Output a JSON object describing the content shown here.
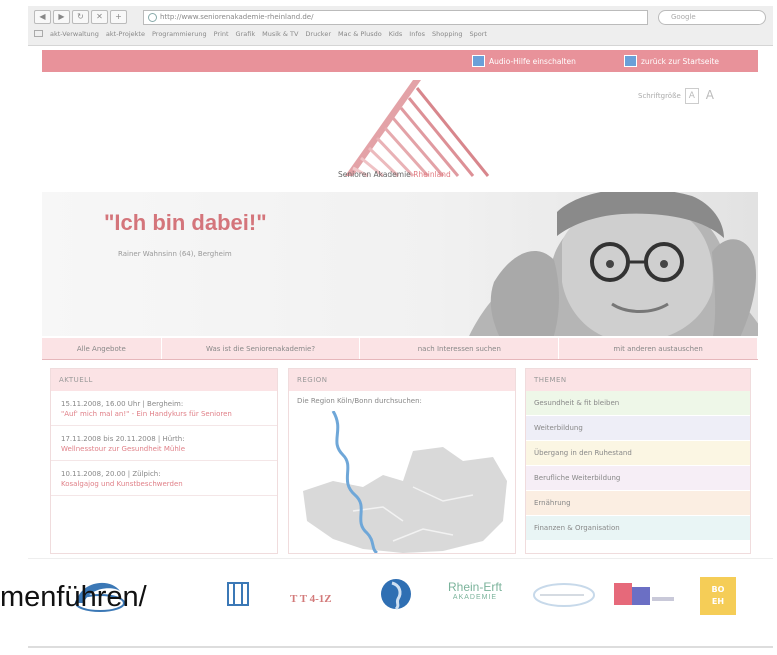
{
  "browser": {
    "url": "http://www.seniorenakademie-rheinland.de/",
    "search_placeholder": "Google",
    "bookmarks": [
      "akt-Verwaltung",
      "akt-Projekte",
      "Programmierung",
      "Print",
      "Grafik",
      "Musik & TV",
      "Drucker",
      "Mac & Plusdo",
      "Kids",
      "Infos",
      "Shopping",
      "Sport"
    ]
  },
  "topbar": {
    "link1": "Audio-Hilfe einschalten",
    "link2": "zurück zur Startseite",
    "bg_color": "#e8929a"
  },
  "header": {
    "brand_main": "Senioren Akademie",
    "brand_highlight": "Rheinland",
    "font_size_label": "Schriftgröße",
    "font_small": "A",
    "font_large": "A"
  },
  "hero": {
    "quote": "\"Ich bin dabei!\"",
    "subline": "Rainer Wahnsinn (64), Bergheim"
  },
  "tabs": [
    "Alle Angebote",
    "Was ist die Seniorenakademie?",
    "nach Interessen suchen",
    "mit anderen austauschen"
  ],
  "aktuell": {
    "title": "AKTUELL",
    "items": [
      {
        "date": "15.11.2008, 16.00 Uhr | Bergheim:",
        "text": "\"Auf' mich mal an!\" - Ein Handykurs für Senioren"
      },
      {
        "date": "17.11.2008 bis 20.11.2008 | Hürth:",
        "text": "Wellnesstour zur Gesundheit Mühle"
      },
      {
        "date": "10.11.2008, 20.00 | Zülpich:",
        "text": "Kosalgajog und Kunstbeschwerden"
      }
    ]
  },
  "region": {
    "title": "REGION",
    "text": "Die Region Köln/Bonn durchsuchen:"
  },
  "themen": {
    "title": "THEMEN",
    "items": [
      {
        "label": "Gesundheit & fit bleiben",
        "color": "#eef7e8"
      },
      {
        "label": "Weiterbildung",
        "color": "#eeeef7"
      },
      {
        "label": "Übergang in den Ruhestand",
        "color": "#fbf6e3"
      },
      {
        "label": "Berufliche Weiterbildung",
        "color": "#f6eef6"
      },
      {
        "label": "Ernährung",
        "color": "#fbeee2"
      },
      {
        "label": "Finanzen & Organisation",
        "color": "#e9f5f5"
      }
    ]
  },
  "partners": {
    "text_logo": "T T 4-1Z",
    "rhein_a": "Rhein-Erft",
    "rhein_b": "AKADEMIE",
    "yellow_a": "BO",
    "yellow_b": "EH"
  },
  "overlay_text": "menführen/"
}
